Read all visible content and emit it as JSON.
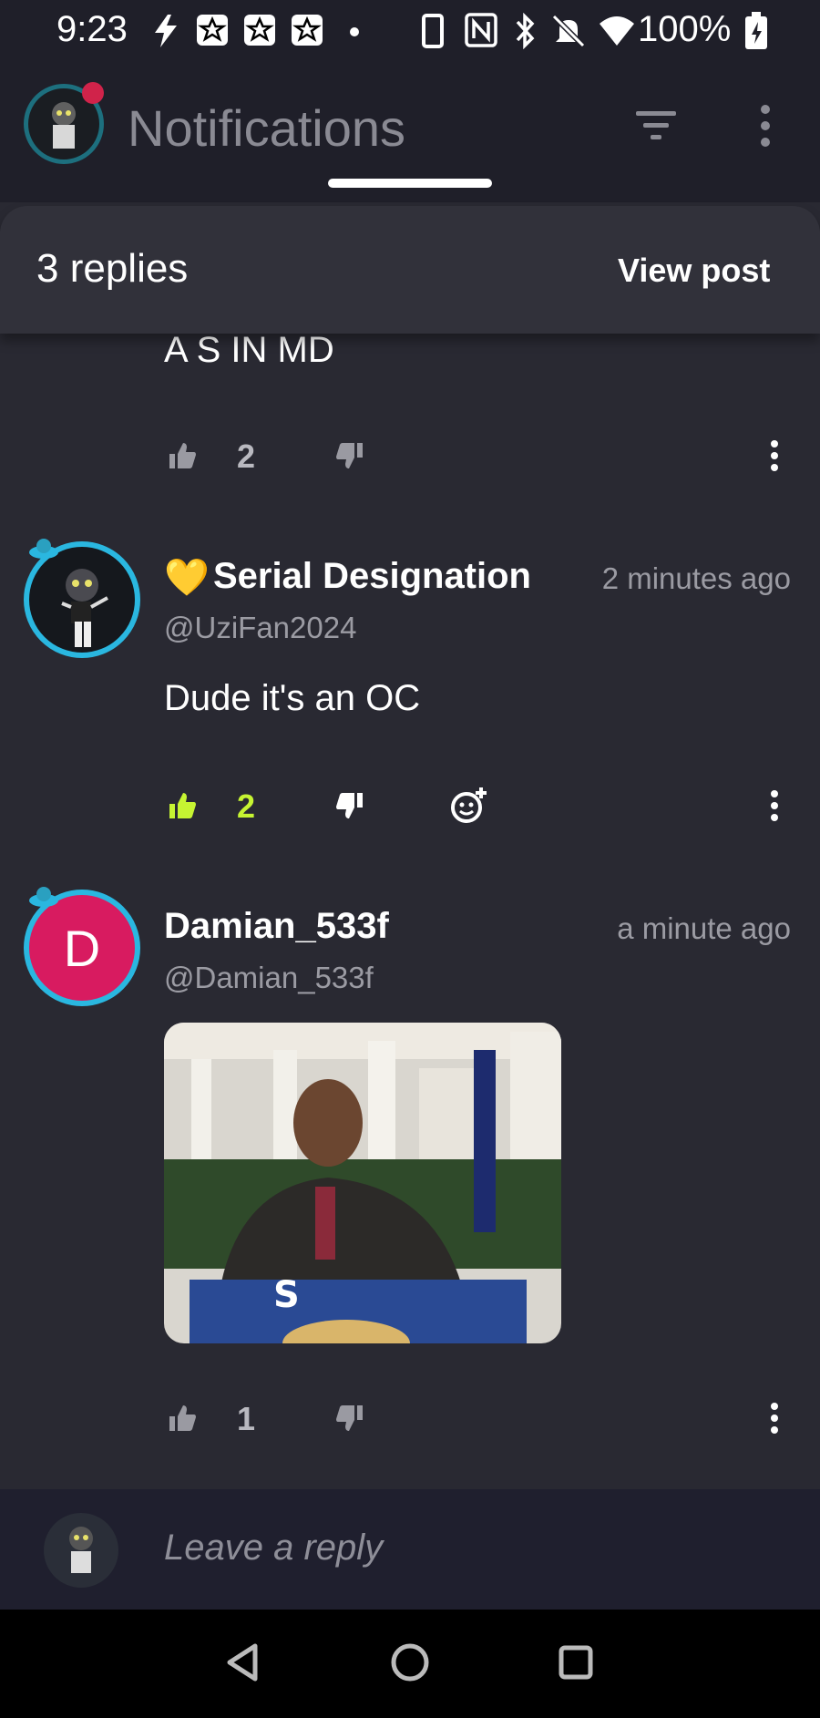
{
  "status_bar": {
    "time": "9:23",
    "battery": "100%"
  },
  "app_bar": {
    "title": "Notifications"
  },
  "sheet": {
    "replies_label": "3 replies",
    "view_post_label": "View post"
  },
  "comments": [
    {
      "text": "A S IN MD",
      "likes": "2"
    },
    {
      "author_emoji": "💛",
      "author": "Serial Designation",
      "handle": "@UziFan2024",
      "time": "2 minutes ago",
      "text": "Dude it's an OC",
      "likes": "2"
    },
    {
      "avatar_letter": "D",
      "author": "Damian_533f",
      "handle": "@Damian_533f",
      "time": "a minute ago",
      "likes": "1"
    }
  ],
  "reply_input": {
    "placeholder": "Leave a reply"
  },
  "colors": {
    "accent": "#c6f432",
    "ring": "#2ab7e0",
    "avatar_d": "#d81b60"
  }
}
